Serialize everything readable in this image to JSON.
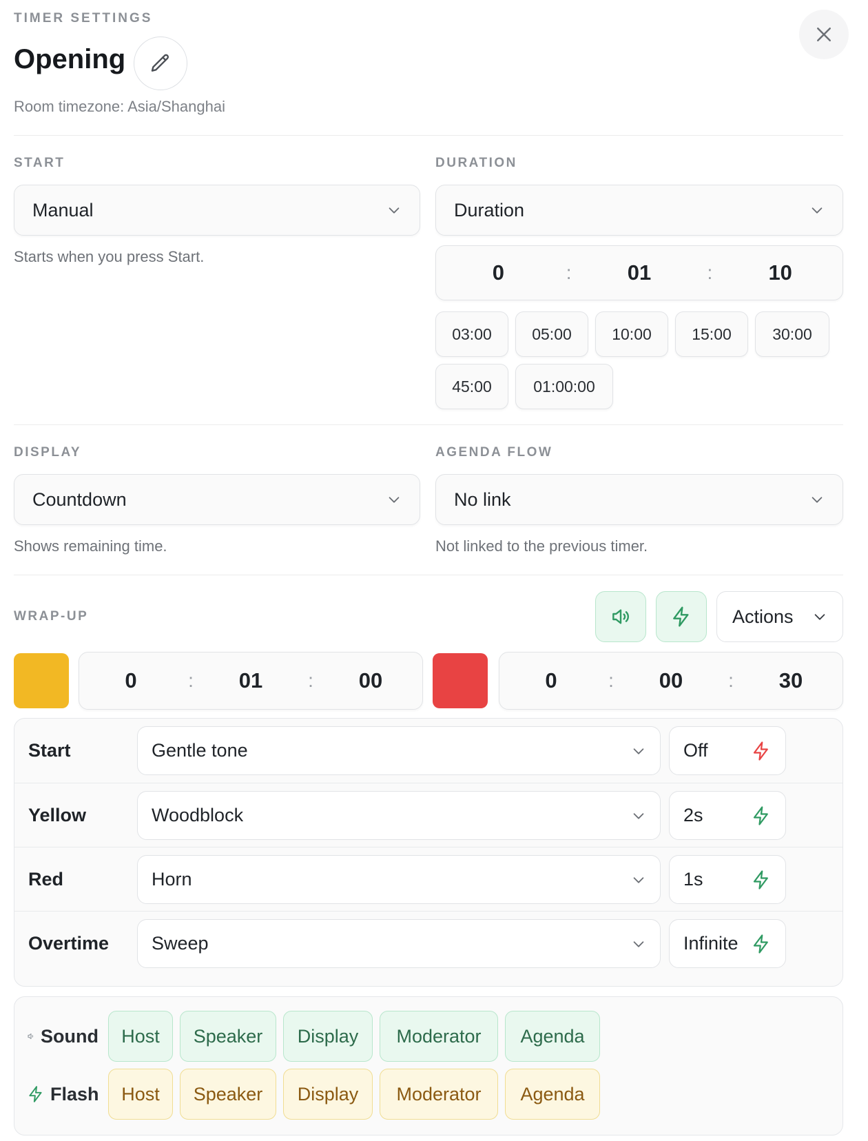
{
  "header": {
    "eyebrow": "TIMER SETTINGS",
    "title": "Opening",
    "timezone": "Room timezone: Asia/Shanghai",
    "icons": {
      "edit": "pencil-icon",
      "close": "close-icon"
    }
  },
  "start": {
    "label": "START",
    "value": "Manual",
    "hint": "Starts when you press Start."
  },
  "duration": {
    "label": "DURATION",
    "value": "Duration",
    "time": {
      "hours": "0",
      "minutes": "01",
      "seconds": "10"
    },
    "presets": [
      "03:00",
      "05:00",
      "10:00",
      "15:00",
      "30:00",
      "45:00",
      "01:00:00"
    ]
  },
  "display": {
    "label": "DISPLAY",
    "value": "Countdown",
    "hint": "Shows remaining time."
  },
  "agenda_flow": {
    "label": "AGENDA FLOW",
    "value": "No link",
    "hint": "Not linked to the previous timer."
  },
  "wrapup": {
    "label": "WRAP-UP",
    "actions_label": "Actions",
    "yellow": {
      "color": "#f2b824",
      "hours": "0",
      "minutes": "01",
      "seconds": "00"
    },
    "red": {
      "color": "#e84343",
      "hours": "0",
      "minutes": "00",
      "seconds": "30"
    },
    "rows": [
      {
        "label": "Start",
        "sound": "Gentle tone",
        "flash": "Off",
        "flash_color": "#e84343"
      },
      {
        "label": "Yellow",
        "sound": "Woodblock",
        "flash": "2s",
        "flash_color": "#2f9a62"
      },
      {
        "label": "Red",
        "sound": "Horn",
        "flash": "1s",
        "flash_color": "#2f9a62"
      },
      {
        "label": "Overtime",
        "sound": "Sweep",
        "flash": "Infinite",
        "flash_color": "#2f9a62"
      }
    ]
  },
  "targets": {
    "sound_label": "Sound",
    "flash_label": "Flash",
    "sound_chips": [
      "Host",
      "Speaker",
      "Display",
      "Moderator",
      "Agenda"
    ],
    "flash_chips": [
      "Host",
      "Speaker",
      "Display",
      "Moderator",
      "Agenda"
    ]
  }
}
